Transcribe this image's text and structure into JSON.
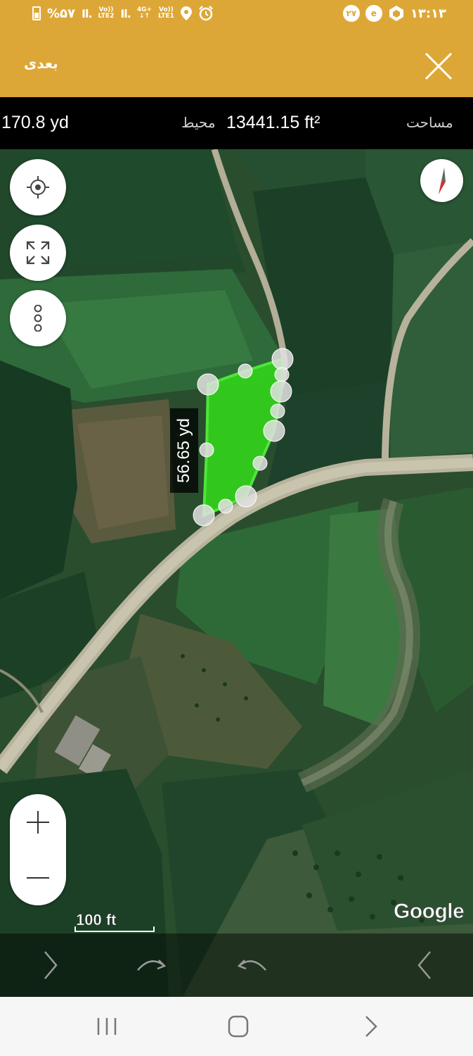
{
  "status_bar": {
    "battery": "%۵۷",
    "network1": "LTE2",
    "network2": "LTE1",
    "net_type": "4G+",
    "volte1": "Vo))",
    "volte2": "Vo))",
    "notification_count": "۲۷",
    "time": "۱۳:۱۳"
  },
  "app_bar": {
    "next_label": "بعدی"
  },
  "measure": {
    "perimeter_value": "170.8 yd",
    "perimeter_label": "محیط",
    "area_value": "13441.15 ft²",
    "area_label": "مساحت"
  },
  "map": {
    "edge_length": "56.65 yd",
    "scale_label": "100 ft",
    "attribution": "Google",
    "polygon_color": "#33d11c"
  }
}
